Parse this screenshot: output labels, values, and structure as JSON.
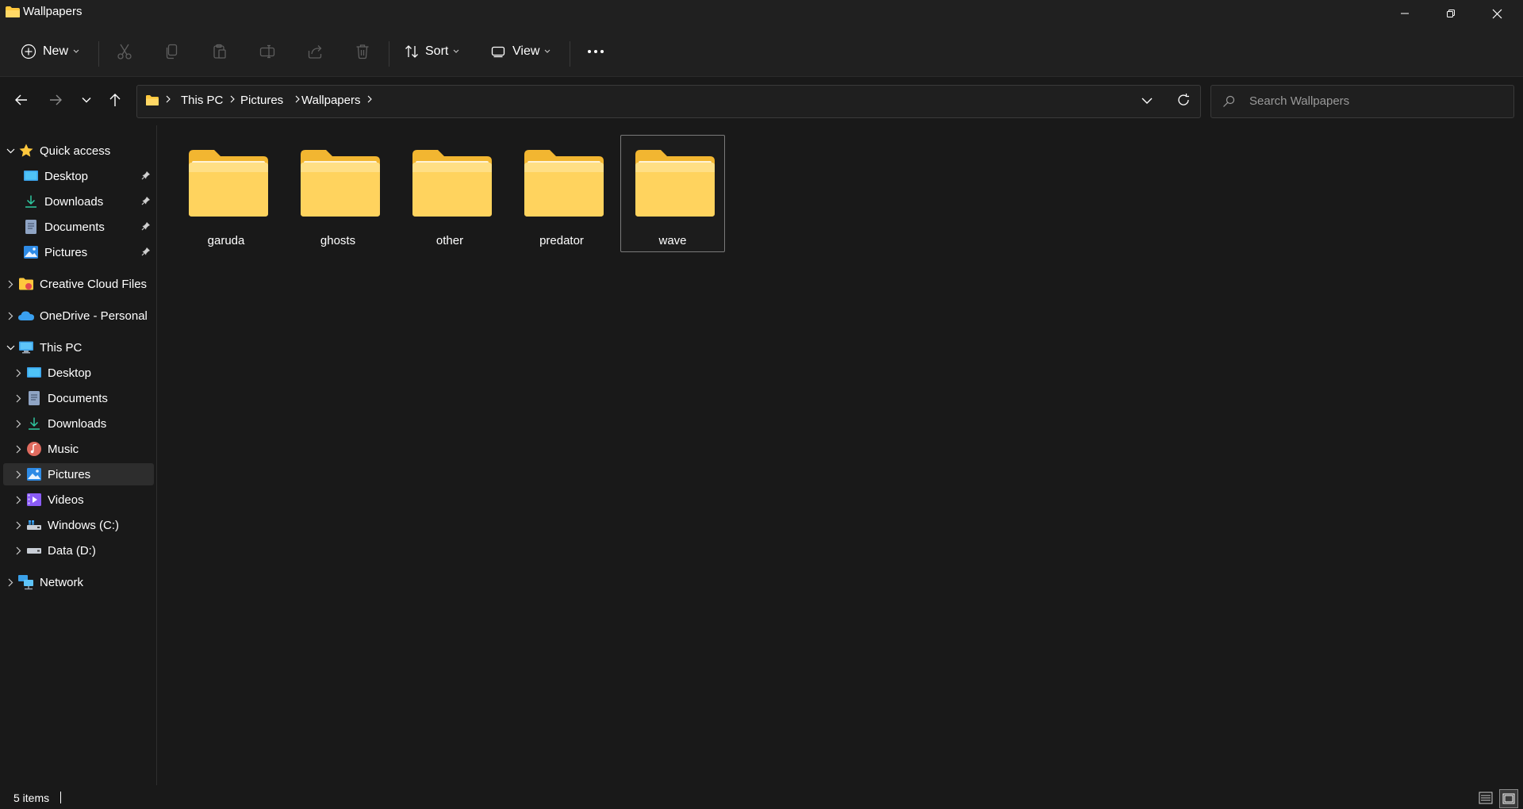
{
  "window": {
    "title": "Wallpapers"
  },
  "toolbar": {
    "new_label": "New",
    "sort_label": "Sort",
    "view_label": "View"
  },
  "breadcrumb": [
    "This PC",
    "Pictures",
    "Wallpapers"
  ],
  "search": {
    "placeholder": "Search Wallpapers"
  },
  "sidebar": {
    "quick_access": {
      "label": "Quick access",
      "items": [
        {
          "label": "Desktop",
          "icon": "desktop-icon"
        },
        {
          "label": "Downloads",
          "icon": "downloads-icon"
        },
        {
          "label": "Documents",
          "icon": "documents-icon"
        },
        {
          "label": "Pictures",
          "icon": "pictures-icon"
        }
      ]
    },
    "creative_cloud": {
      "label": "Creative Cloud Files"
    },
    "onedrive": {
      "label": "OneDrive - Personal"
    },
    "this_pc": {
      "label": "This PC",
      "items": [
        {
          "label": "Desktop",
          "icon": "desktop-icon"
        },
        {
          "label": "Documents",
          "icon": "documents-icon"
        },
        {
          "label": "Downloads",
          "icon": "downloads-icon"
        },
        {
          "label": "Music",
          "icon": "music-icon"
        },
        {
          "label": "Pictures",
          "icon": "pictures-icon",
          "selected": true
        },
        {
          "label": "Videos",
          "icon": "videos-icon"
        },
        {
          "label": "Windows (C:)",
          "icon": "drive-c-icon"
        },
        {
          "label": "Data (D:)",
          "icon": "drive-d-icon"
        }
      ]
    },
    "network": {
      "label": "Network"
    }
  },
  "folders": [
    {
      "name": "garuda"
    },
    {
      "name": "ghosts"
    },
    {
      "name": "other"
    },
    {
      "name": "predator"
    },
    {
      "name": "wave",
      "selected": true
    }
  ],
  "status": {
    "item_count": "5 items"
  },
  "colors": {
    "background": "#191919",
    "chrome": "#202020",
    "folder_yellow": "#FFC83D",
    "folder_light": "#FFE08A",
    "selection": "#2d2d2d"
  }
}
